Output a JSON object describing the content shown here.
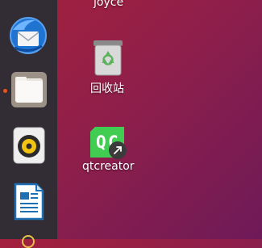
{
  "dock": {
    "items": [
      {
        "name": "thunderbird-icon",
        "running": false
      },
      {
        "name": "files-icon",
        "running": true
      },
      {
        "name": "rhythmbox-icon",
        "running": false
      },
      {
        "name": "libreoffice-writer-icon",
        "running": false
      }
    ]
  },
  "desktop": {
    "user_folder_label": "joyce",
    "trash_label": "回收站",
    "qtcreator_label": "qtcreator"
  },
  "colors": {
    "dock_bg": "#322d34",
    "accent": "#e95420",
    "qt_green": "#41cd52"
  }
}
